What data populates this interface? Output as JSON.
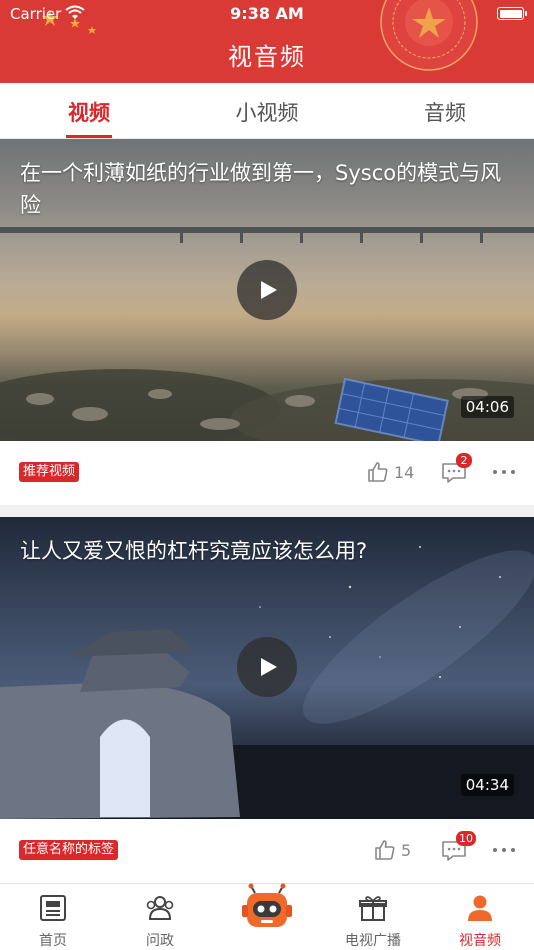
{
  "status_bar": {
    "carrier": "Carrier",
    "time": "9:38 AM"
  },
  "header": {
    "title": "视音频"
  },
  "tabs": [
    {
      "label": "视频",
      "active": true
    },
    {
      "label": "小视频",
      "active": false
    },
    {
      "label": "音频",
      "active": false
    }
  ],
  "videos": [
    {
      "title": "在一个利薄如纸的行业做到第一，Sysco的模式与风险",
      "duration": "04:06",
      "tag": "推荐视频",
      "likes": "14",
      "comments_badge": "2"
    },
    {
      "title": "让人又爱又恨的杠杆究竟应该怎么用?",
      "duration": "04:34",
      "tag": "任意名称的标签",
      "likes": "5",
      "comments_badge": "10"
    }
  ],
  "bottom_nav": [
    {
      "label": "首页",
      "icon": "news-icon",
      "active": false
    },
    {
      "label": "问政",
      "icon": "people-icon",
      "active": false
    },
    {
      "label": "",
      "icon": "robot-icon",
      "active": false
    },
    {
      "label": "电视广播",
      "icon": "gift-box-icon",
      "active": false
    },
    {
      "label": "视音频",
      "icon": "person-icon",
      "active": true
    }
  ],
  "colors": {
    "brand_red": "#d93a36",
    "accent_red": "#d9282b"
  }
}
